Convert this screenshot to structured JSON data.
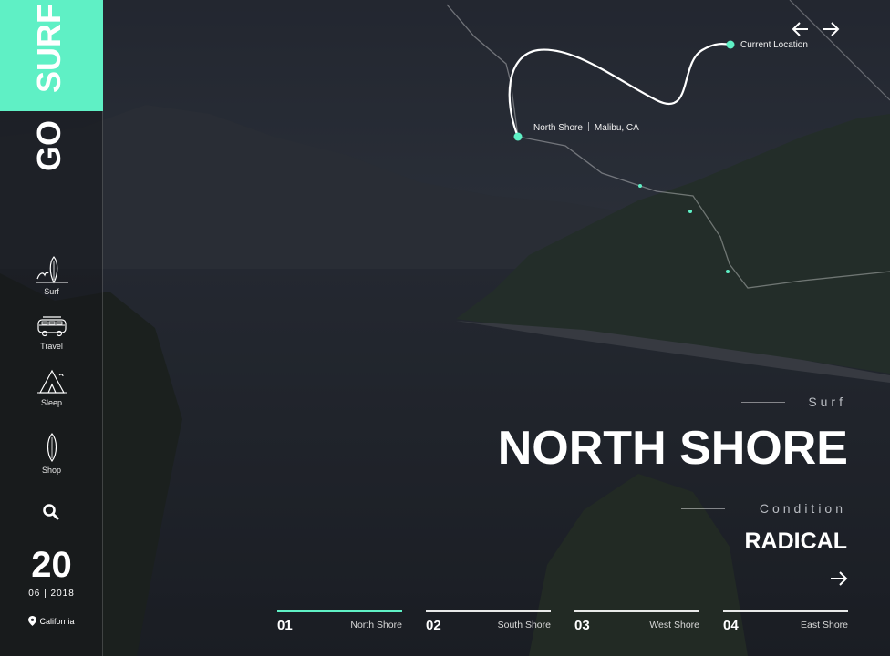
{
  "brand": {
    "word1": "GO",
    "word2": "SURF",
    "accent": "#5ff0c5"
  },
  "nav": [
    {
      "label": "Surf",
      "icon": "surf-icon"
    },
    {
      "label": "Travel",
      "icon": "van-icon"
    },
    {
      "label": "Sleep",
      "icon": "tent-icon"
    },
    {
      "label": "Shop",
      "icon": "surfboard-icon"
    }
  ],
  "date": {
    "day": "20",
    "month_year": "06 | 2018"
  },
  "location": "California",
  "map": {
    "current_location": "Current Location",
    "spot": "North Shore",
    "city": "Malibu, CA"
  },
  "hero": {
    "category": "Surf",
    "title": "NORTH SHORE",
    "condition_label": "Condition",
    "condition_value": "RADICAL"
  },
  "tabs": [
    {
      "num": "01",
      "name": "North Shore",
      "active": true
    },
    {
      "num": "02",
      "name": "South Shore",
      "active": false
    },
    {
      "num": "03",
      "name": "West Shore",
      "active": false
    },
    {
      "num": "04",
      "name": "East Shore",
      "active": false
    }
  ]
}
